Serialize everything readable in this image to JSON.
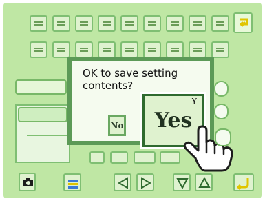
{
  "screen": {
    "dialog": {
      "message": "OK to save setting contents?",
      "no_label": "No",
      "yes_label": "Yes",
      "yes_hint": "Y"
    }
  }
}
